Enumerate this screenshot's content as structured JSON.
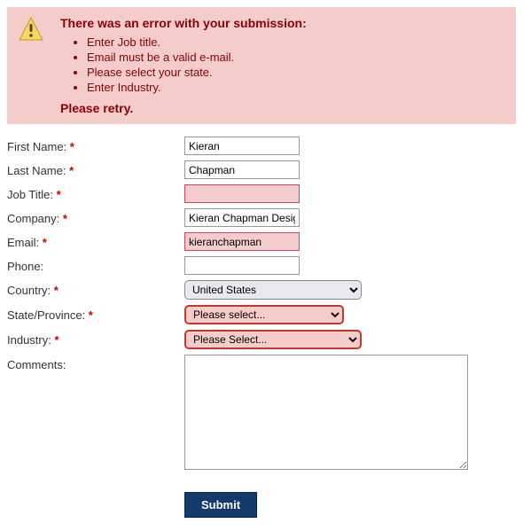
{
  "error_box": {
    "heading": "There was an error with your submission:",
    "items": [
      "Enter Job title.",
      "Email must be a valid e-mail.",
      "Please select your state.",
      "Enter Industry."
    ],
    "retry": "Please retry."
  },
  "labels": {
    "first_name": "First Name:",
    "last_name": "Last Name:",
    "job_title": "Job Title:",
    "company": "Company:",
    "email": "Email:",
    "phone": "Phone:",
    "country": "Country:",
    "state": "State/Province:",
    "industry": "Industry:",
    "comments": "Comments:"
  },
  "required_mark": "*",
  "values": {
    "first_name": "Kieran",
    "last_name": "Chapman",
    "job_title": "",
    "company": "Kieran Chapman Design",
    "email": "kieranchapman",
    "phone": "",
    "country": "United States",
    "state": "Please select...",
    "industry": "Please Select...",
    "comments": ""
  },
  "submit_label": "Submit"
}
